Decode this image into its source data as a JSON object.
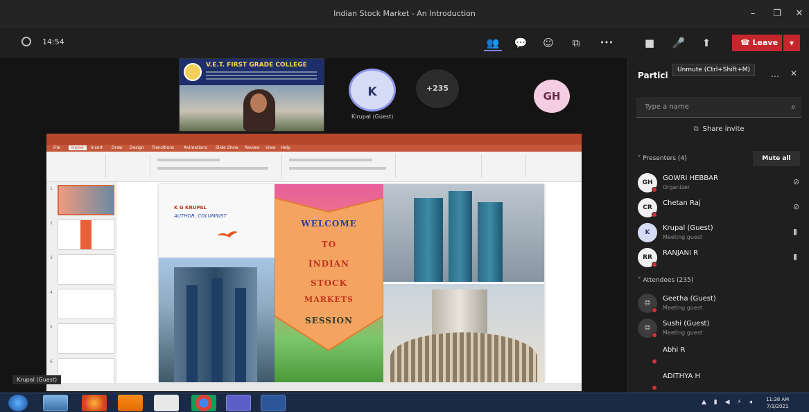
{
  "window": {
    "title": "Indian Stock Market - An Introduction",
    "minimize": "–",
    "maximize": "❐",
    "close": "✕"
  },
  "toolbar": {
    "timer": "14:54",
    "leave_label": "Leave",
    "more_label": "•••",
    "icons": {
      "people": "👥",
      "chat": "💬",
      "reactions": "☺",
      "rooms": "⧉",
      "camera": "■",
      "mic": "🎤",
      "share": "⬆"
    }
  },
  "stage": {
    "video_tile": {
      "college_name": "V.E.T. FIRST GRADE COLLEGE"
    },
    "tiles": [
      {
        "initials": "K",
        "label": "Kirupal (Guest)"
      },
      {
        "initials": "+235",
        "label": ""
      },
      {
        "initials": "GH",
        "label": ""
      }
    ],
    "pinned_label": "Krupal (Guest)"
  },
  "presentation": {
    "tabs": [
      "File",
      "Home",
      "Insert",
      "Draw",
      "Design",
      "Transitions",
      "Animations",
      "Slide Show",
      "Review",
      "View",
      "Help"
    ],
    "active_tab": "Home",
    "slide": {
      "presenter": "K G KRUPAL",
      "role": "AUTHOR, COLUMNIST",
      "welcome_lines": [
        "WELCOME",
        "TO",
        "INDIAN",
        "STOCK",
        "MARKETS",
        "SESSION"
      ]
    },
    "thumb_numbers": [
      "1",
      "2",
      "3",
      "4",
      "5",
      "6"
    ]
  },
  "side_panel": {
    "title": "Partici",
    "tooltip": "Unmute (Ctrl+Shift+M)",
    "search_placeholder": "Type a name",
    "share_invite": "Share invite",
    "presenters_section": "Presenters (4)",
    "mute_all": "Mute all",
    "attendees_section": "Attendees (235)",
    "presenters": [
      {
        "initials": "GH",
        "name": "GOWRI HEBBAR",
        "role": "Organizer"
      },
      {
        "initials": "CR",
        "name": "Chetan Raj",
        "role": ""
      },
      {
        "initials": "K",
        "name": "Krupal (Guest)",
        "role": "Meeting guest"
      },
      {
        "initials": "RR",
        "name": "RANJANI R",
        "role": ""
      }
    ],
    "attendees": [
      {
        "initials": "",
        "name": "Geetha (Guest)",
        "role": "Meeting guest"
      },
      {
        "initials": "",
        "name": "Sushi (Guest)",
        "role": "Meeting guest"
      },
      {
        "initials": "",
        "name": "Abhi R",
        "role": ""
      },
      {
        "initials": "",
        "name": "ADITHYA H",
        "role": ""
      }
    ]
  },
  "taskbar": {
    "time": "11:38 AM",
    "date": "7/3/2021",
    "tray": "▲ ▮ ◀ ⚡ ◂"
  },
  "colors": {
    "leave_red": "#c4262c",
    "accent": "#7f85f5",
    "ppt_orange": "#b7472a"
  }
}
